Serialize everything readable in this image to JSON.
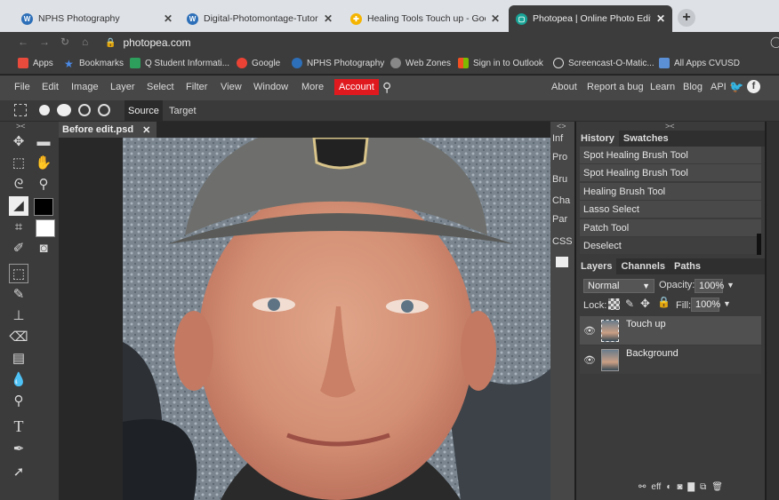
{
  "browser": {
    "tabs": [
      {
        "title": "NPHS Photography",
        "fav_color": "#2d6fb8",
        "fav_glyph": "W"
      },
      {
        "title": "Digital-Photomontage-Tutorial.p",
        "fav_color": "#2d6fb8",
        "fav_glyph": "W"
      },
      {
        "title": "Healing Tools Touch up - Googl",
        "fav_color": "#f4b400",
        "fav_glyph": "✚"
      },
      {
        "title": "Photopea | Online Photo Editor",
        "fav_color": "#18a497",
        "fav_glyph": "▢"
      }
    ],
    "close_glyph": "✕",
    "new_tab_glyph": "+",
    "url": "photopea.com",
    "bookmarks": [
      {
        "label": "Apps",
        "icon": "apps-grid-icon",
        "color": "#e84a3c"
      },
      {
        "label": "Bookmarks",
        "icon": "star-icon",
        "color": "#4a8be8"
      },
      {
        "label": "Q Student Informati...",
        "icon": "q-icon",
        "color": "#2d9e5c"
      },
      {
        "label": "Google",
        "icon": "google-icon",
        "color": "#ea4335"
      },
      {
        "label": "NPHS Photography",
        "icon": "wordpress-icon",
        "color": "#2d6fb8"
      },
      {
        "label": "Web Zones",
        "icon": "globe-icon",
        "color": "#888888"
      },
      {
        "label": "Sign in to Outlook",
        "icon": "microsoft-icon",
        "color": "#f25022"
      },
      {
        "label": "Screencast-O-Matic...",
        "icon": "record-icon",
        "color": "#3a3a3a"
      },
      {
        "label": "All Apps CVUSD",
        "icon": "folder-icon",
        "color": "#5b8fd6"
      }
    ]
  },
  "menu": {
    "items": [
      "File",
      "Edit",
      "Image",
      "Layer",
      "Select",
      "Filter",
      "View",
      "Window",
      "More"
    ],
    "account": "Account",
    "right": [
      "About",
      "Report a bug",
      "Learn",
      "Blog",
      "API"
    ]
  },
  "options": {
    "source": "Source",
    "target": "Target"
  },
  "document": {
    "tab": "Before edit.psd",
    "close": "✕"
  },
  "side_buttons": [
    "Inf",
    "Pro",
    "Bru",
    "Cha",
    "Par",
    "CSS"
  ],
  "history_panel": {
    "tabs": [
      "History",
      "Swatches"
    ],
    "items": [
      "Spot Healing Brush Tool",
      "Spot Healing Brush Tool",
      "Healing Brush Tool",
      "Lasso Select",
      "Patch Tool",
      "Deselect"
    ]
  },
  "layers_panel": {
    "tabs": [
      "Layers",
      "Channels",
      "Paths"
    ],
    "blend_mode": "Normal",
    "opacity_label": "Opacity:",
    "opacity": "100%",
    "lock_label": "Lock:",
    "fill_label": "Fill:",
    "fill": "100%",
    "layers": [
      {
        "name": "Touch up",
        "selected": true
      },
      {
        "name": "Background",
        "selected": false
      }
    ],
    "footer_off": "eff"
  },
  "collapse_glyph": "><",
  "expand_glyph": "<>"
}
